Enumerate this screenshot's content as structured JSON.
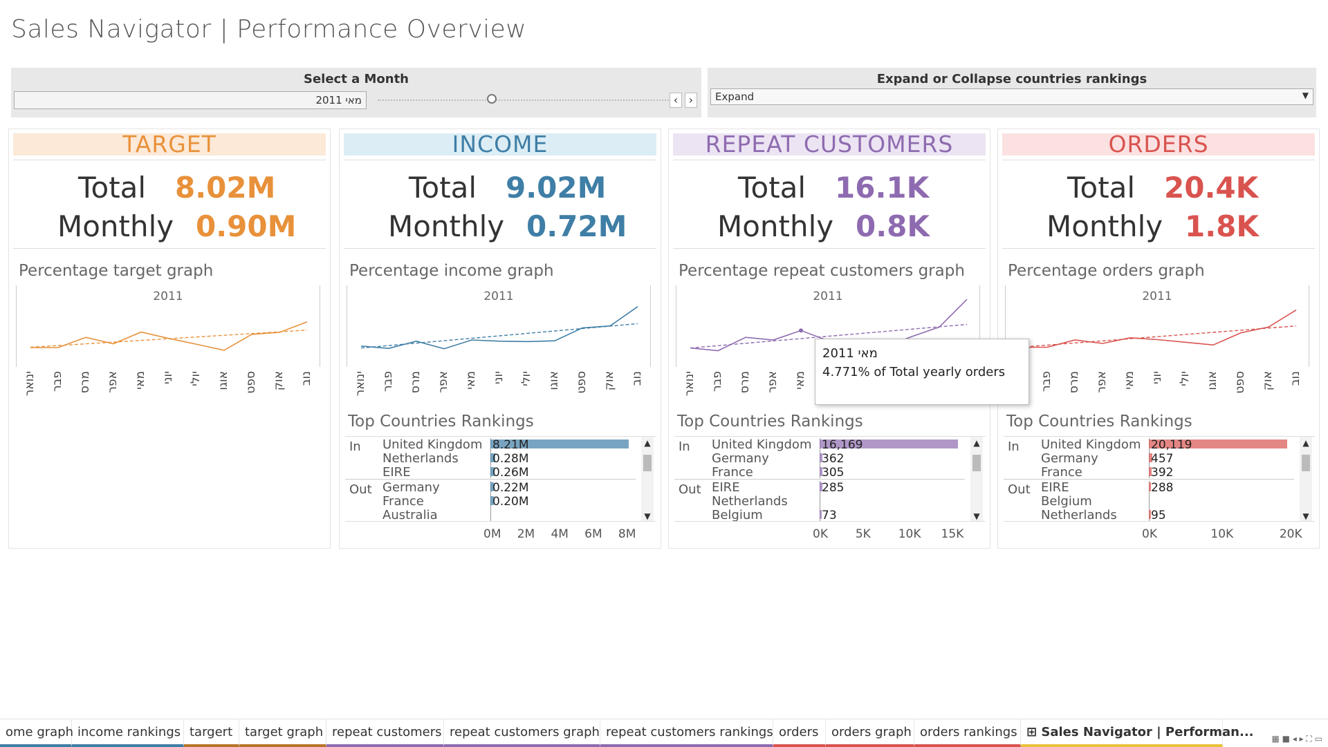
{
  "title": "Sales Navigator | Performance Overview",
  "filters": {
    "month_label": "Select a Month",
    "month_value": "מאי 2011",
    "slider_position": 0.36,
    "prev_icon": "chevron-left-icon",
    "next_icon": "chevron-right-icon",
    "expand_label": "Expand or Collapse countries rankings",
    "expand_value": "Expand"
  },
  "months": [
    "ינואר",
    "פבר",
    "מרס",
    "אפר",
    "מאי",
    "יוני",
    "יולי",
    "אוגו",
    "ספט",
    "אוק",
    "נוב"
  ],
  "cards": [
    {
      "key": "target",
      "header": "TARGET",
      "color": "#e8913a",
      "header_bg": "#fce9d8",
      "total_label": "Total",
      "total_value": "8.02M",
      "monthly_label": "Monthly",
      "monthly_value": "0.90M",
      "graph_title": "Percentage target graph",
      "year": "2011",
      "chart_data": {
        "type": "line",
        "title": "",
        "x": [
          "ינואר",
          "פבר",
          "מרס",
          "אפר",
          "מאי",
          "יוני",
          "יולי",
          "אוגו",
          "ספט",
          "אוק",
          "נוב"
        ],
        "series": [
          {
            "values": [
              5.9,
              5.9,
              8.6,
              6.9,
              10.0,
              8.3,
              6.8,
              5.2,
              9.4,
              9.9,
              12.7
            ]
          }
        ],
        "trend": [
          6.0,
          10.5
        ]
      }
    },
    {
      "key": "income",
      "header": "INCOME",
      "color": "#3f7ea6",
      "header_bg": "#dcedf5",
      "total_label": "Total",
      "total_value": "9.02M",
      "monthly_label": "Monthly",
      "monthly_value": "0.72M",
      "graph_title": "Percentage income graph",
      "year": "2011",
      "chart_data": {
        "type": "line",
        "title": "",
        "x": [
          "ינואר",
          "פבר",
          "מרס",
          "אפר",
          "מאי",
          "יוני",
          "יולי",
          "אוגו",
          "ספט",
          "אוק",
          "נוב"
        ],
        "series": [
          {
            "values": [
              6.3,
              5.7,
              7.6,
              5.6,
              7.9,
              7.6,
              7.5,
              7.7,
              11.1,
              11.6,
              16.7
            ]
          }
        ],
        "trend": [
          5.8,
          12.2
        ]
      },
      "rankings": {
        "title": "Top Countries Rankings",
        "groups": [
          {
            "label": "In",
            "items": [
              {
                "name": "United Kingdom",
                "value": 8.21,
                "text": "8.21M"
              },
              {
                "name": "Netherlands",
                "value": 0.28,
                "text": "0.28M"
              },
              {
                "name": "EIRE",
                "value": 0.26,
                "text": "0.26M"
              }
            ]
          },
          {
            "label": "Out",
            "items": [
              {
                "name": "Germany",
                "value": 0.22,
                "text": "0.22M"
              },
              {
                "name": "France",
                "value": 0.2,
                "text": "0.20M"
              },
              {
                "name": "Australia",
                "value": 0.0,
                "text": ""
              }
            ]
          }
        ],
        "axis_max": 8.21,
        "ticks": [
          {
            "v": 0,
            "t": "0M"
          },
          {
            "v": 2,
            "t": "2M"
          },
          {
            "v": 4,
            "t": "4M"
          },
          {
            "v": 6,
            "t": "6M"
          },
          {
            "v": 8,
            "t": "8M"
          }
        ]
      }
    },
    {
      "key": "repeat",
      "header": "REPEAT CUSTOMERS",
      "color": "#8e6bb0",
      "header_bg": "#ece4f3",
      "total_label": "Total",
      "total_value": "16.1K",
      "monthly_label": "Monthly",
      "monthly_value": "0.8K",
      "graph_title": "Percentage repeat customers graph",
      "year": "2011",
      "chart_data": {
        "type": "line",
        "title": "",
        "x": [
          "ינואר",
          "פבר",
          "מרס",
          "אפר",
          "מאי",
          "יוני",
          "יולי",
          "אוגו",
          "ספט",
          "אוק",
          "נוב"
        ],
        "series": [
          {
            "values": [
              5.8,
              5.1,
              8.6,
              7.9,
              10.4,
              7.7,
              7.0,
              6.0,
              8.8,
              11.3,
              18.6
            ]
          }
        ],
        "trend": [
          5.8,
          12.0
        ]
      },
      "rankings": {
        "title": "Top Countries Rankings",
        "groups": [
          {
            "label": "In",
            "items": [
              {
                "name": "United Kingdom",
                "value": 16169,
                "text": "16,169"
              },
              {
                "name": "Germany",
                "value": 362,
                "text": "362"
              },
              {
                "name": "France",
                "value": 305,
                "text": "305"
              }
            ]
          },
          {
            "label": "Out",
            "items": [
              {
                "name": "EIRE",
                "value": 285,
                "text": "285"
              },
              {
                "name": "Netherlands",
                "value": 0,
                "text": ""
              },
              {
                "name": "Belgium",
                "value": 73,
                "text": "73"
              }
            ]
          }
        ],
        "axis_max": 16169,
        "ticks": [
          {
            "v": 0,
            "t": "0K"
          },
          {
            "v": 5000,
            "t": "5K"
          },
          {
            "v": 10000,
            "t": "10K"
          },
          {
            "v": 15000,
            "t": "15K"
          }
        ]
      }
    },
    {
      "key": "orders",
      "header": "ORDERS",
      "color": "#d9534f",
      "header_bg": "#fbe1e1",
      "total_label": "Total",
      "total_value": "20.4K",
      "monthly_label": "Monthly",
      "monthly_value": "1.8K",
      "graph_title": "Percentage orders graph",
      "year": "2011",
      "chart_data": {
        "type": "line",
        "title": "",
        "x": [
          "ינואר",
          "פבר",
          "מרס",
          "אפר",
          "מאי",
          "יוני",
          "יולי",
          "אוגו",
          "ספט",
          "אוק",
          "נוב"
        ],
        "series": [
          {
            "values": [
              6.0,
              6.0,
              7.9,
              7.0,
              8.5,
              8.0,
              7.3,
              6.6,
              9.8,
              11.3,
              15.8
            ]
          }
        ],
        "trend": [
          6.0,
          11.6
        ]
      },
      "rankings": {
        "title": "Top Countries Rankings",
        "groups": [
          {
            "label": "In",
            "items": [
              {
                "name": "United Kingdom",
                "value": 20119,
                "text": "20,119"
              },
              {
                "name": "Germany",
                "value": 457,
                "text": "457"
              },
              {
                "name": "France",
                "value": 392,
                "text": "392"
              }
            ]
          },
          {
            "label": "Out",
            "items": [
              {
                "name": "EIRE",
                "value": 288,
                "text": "288"
              },
              {
                "name": "Belgium",
                "value": 0,
                "text": ""
              },
              {
                "name": "Netherlands",
                "value": 95,
                "text": "95"
              }
            ]
          }
        ],
        "axis_max": 20119,
        "ticks": [
          {
            "v": 0,
            "t": "0K"
          },
          {
            "v": 10000,
            "t": "10K"
          },
          {
            "v": 20000,
            "t": "20K"
          }
        ]
      }
    }
  ],
  "tooltip": {
    "line1": "מאי 2011",
    "line2": "4.771%  of Total yearly orders"
  },
  "tabs": [
    {
      "label": "ome graph",
      "color": "#3f7ea6"
    },
    {
      "label": "income rankings",
      "color": "#3f7ea6"
    },
    {
      "label": "targert",
      "color": "#b8732a"
    },
    {
      "label": "target graph",
      "color": "#b8732a"
    },
    {
      "label": "repeat customers",
      "color": "#8e6bb0"
    },
    {
      "label": "repeat customers graph",
      "color": "#8e6bb0"
    },
    {
      "label": "repeat customers rankings",
      "color": "#8e6bb0"
    },
    {
      "label": "orders",
      "color": "#d9534f"
    },
    {
      "label": "orders graph",
      "color": "#d9534f"
    },
    {
      "label": "orders rankings",
      "color": "#d9534f"
    },
    {
      "label": "Sales Navigator | Performan...",
      "color": "#e8c23a",
      "active": true,
      "icon": "dashboard-icon"
    }
  ]
}
